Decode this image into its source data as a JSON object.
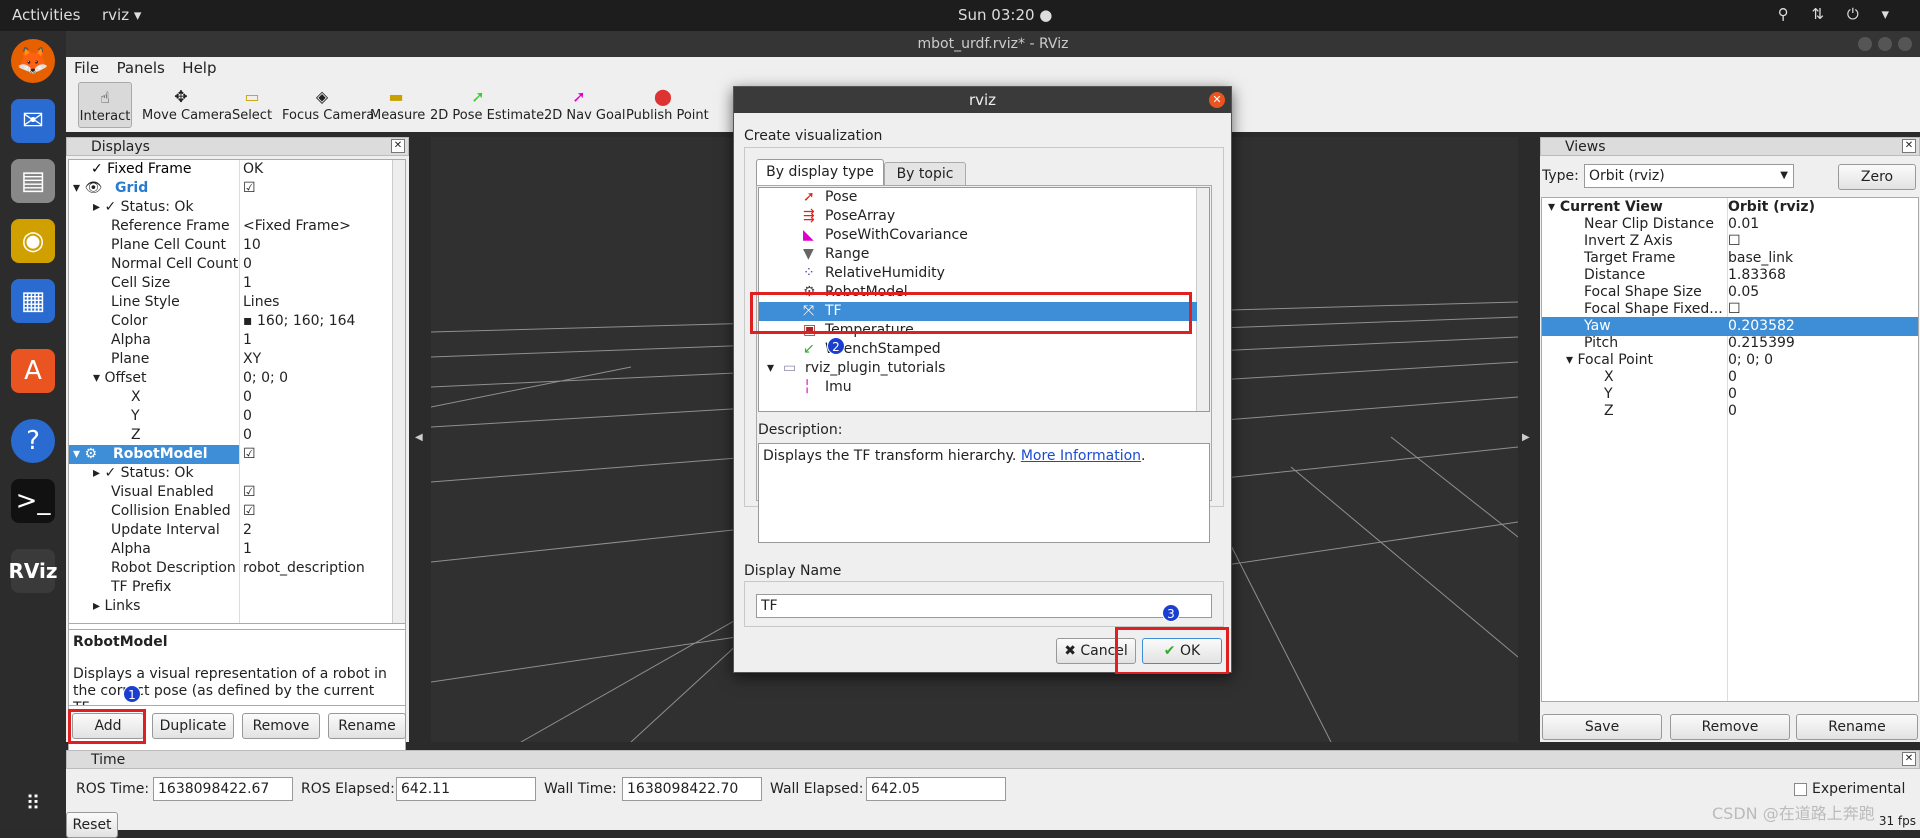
{
  "system": {
    "activities": "Activities",
    "app": "rviz ▾",
    "clock": "Sun 03:20 ●",
    "tray": "⚲ ⇅ ⏻ ▾"
  },
  "window": {
    "title": "mbot_urdf.rviz* - RViz"
  },
  "menu": [
    "File",
    "Panels",
    "Help"
  ],
  "toolbar": [
    {
      "label": "Interact",
      "icon": "☝"
    },
    {
      "label": "Move Camera",
      "icon": "✥"
    },
    {
      "label": "Select",
      "icon": "▭"
    },
    {
      "label": "Focus Camera",
      "icon": "◈"
    },
    {
      "label": "Measure",
      "icon": "▬"
    },
    {
      "label": "2D Pose Estimate",
      "icon": "➚"
    },
    {
      "label": "2D Nav Goal",
      "icon": "➚"
    },
    {
      "label": "Publish Point",
      "icon": "⬤"
    }
  ],
  "displays": {
    "title": "Displays",
    "rows": [
      {
        "k": "✓ Fixed Frame",
        "v": "OK"
      },
      {
        "k": "Grid",
        "v": "☑"
      },
      {
        "k": "▸ ✓ Status: Ok",
        "v": ""
      },
      {
        "k": "Reference Frame",
        "v": "<Fixed Frame>"
      },
      {
        "k": "Plane Cell Count",
        "v": "10"
      },
      {
        "k": "Normal Cell Count",
        "v": "0"
      },
      {
        "k": "Cell Size",
        "v": "1"
      },
      {
        "k": "Line Style",
        "v": "Lines"
      },
      {
        "k": "Color",
        "v": "▪ 160; 160; 164"
      },
      {
        "k": "Alpha",
        "v": "1"
      },
      {
        "k": "Plane",
        "v": "XY"
      },
      {
        "k": "▾ Offset",
        "v": "0; 0; 0"
      },
      {
        "k": "X",
        "v": "0"
      },
      {
        "k": "Y",
        "v": "0"
      },
      {
        "k": "Z",
        "v": "0"
      },
      {
        "k": "RobotModel",
        "v": "☑"
      },
      {
        "k": "▸ ✓ Status: Ok",
        "v": ""
      },
      {
        "k": "Visual Enabled",
        "v": "☑"
      },
      {
        "k": "Collision Enabled",
        "v": "☑"
      },
      {
        "k": "Update Interval",
        "v": "2"
      },
      {
        "k": "Alpha",
        "v": "1"
      },
      {
        "k": "Robot Description",
        "v": "robot_description"
      },
      {
        "k": "TF Prefix",
        "v": ""
      },
      {
        "k": "▸ Links",
        "v": ""
      }
    ],
    "desc_title": "RobotModel",
    "desc_text": "Displays a visual representation of a robot in the correct pose (as defined by the current TF",
    "buttons": [
      "Add",
      "Duplicate",
      "Remove",
      "Rename"
    ]
  },
  "dialog": {
    "title": "rviz",
    "heading": "Create visualization",
    "tabs": [
      "By display type",
      "By topic"
    ],
    "items": [
      "Pose",
      "PoseArray",
      "PoseWithCovariance",
      "Range",
      "RelativeHumidity",
      "RobotModel",
      "TF",
      "Temperature",
      "WrenchStamped",
      "rviz_plugin_tutorials",
      "Imu"
    ],
    "desc_label": "Description:",
    "desc_text": "Displays the TF transform hierarchy.",
    "desc_link": "More Information",
    "name_label": "Display Name",
    "name_value": "TF",
    "cancel": "Cancel",
    "ok": "OK"
  },
  "views": {
    "title": "Views",
    "type_label": "Type:",
    "type_value": "Orbit (rviz)",
    "zero": "Zero",
    "rows": [
      {
        "k": "▾ Current View",
        "v": "Orbit (rviz)"
      },
      {
        "k": "Near Clip Distance",
        "v": "0.01"
      },
      {
        "k": "Invert Z Axis",
        "v": "☐"
      },
      {
        "k": "Target Frame",
        "v": "base_link"
      },
      {
        "k": "Distance",
        "v": "1.83368"
      },
      {
        "k": "Focal Shape Size",
        "v": "0.05"
      },
      {
        "k": "Focal Shape Fixed...",
        "v": "☐"
      },
      {
        "k": "Yaw",
        "v": "0.203582"
      },
      {
        "k": "Pitch",
        "v": "0.215399"
      },
      {
        "k": "▾ Focal Point",
        "v": "0; 0; 0"
      },
      {
        "k": "X",
        "v": "0"
      },
      {
        "k": "Y",
        "v": "0"
      },
      {
        "k": "Z",
        "v": "0"
      }
    ],
    "buttons": [
      "Save",
      "Remove",
      "Rename"
    ]
  },
  "time": {
    "title": "Time",
    "ros_time_label": "ROS Time:",
    "ros_time": "1638098422.67",
    "ros_elapsed_label": "ROS Elapsed:",
    "ros_elapsed": "642.11",
    "wall_time_label": "Wall Time:",
    "wall_time": "1638098422.70",
    "wall_elapsed_label": "Wall Elapsed:",
    "wall_elapsed": "642.05",
    "experimental": "Experimental",
    "reset": "Reset",
    "fps": "31 fps"
  },
  "watermark": "CSDN @在道路上奔跑",
  "badges": [
    "1",
    "2",
    "3"
  ],
  "colors": {
    "selection": "#3d8ed6",
    "annotation": "#e02020",
    "badge": "#1a3fd0"
  }
}
